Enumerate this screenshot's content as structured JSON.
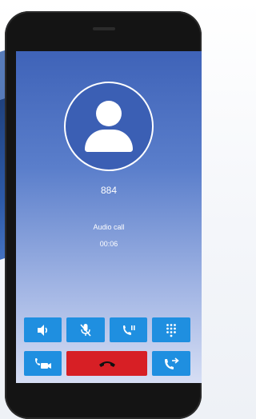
{
  "call": {
    "caller_number": "884",
    "type_label": "Audio call",
    "duration": "00:06"
  },
  "colors": {
    "screen_top": "#3f63b8",
    "button_blue": "#1f8fe0",
    "hangup_red": "#d71f25"
  },
  "controls": {
    "row1": [
      "speaker-icon",
      "mute-mic-icon",
      "hold-call-icon",
      "dialpad-icon"
    ],
    "row2": [
      "video-call-icon",
      "hang-up-icon",
      "transfer-call-icon"
    ]
  }
}
